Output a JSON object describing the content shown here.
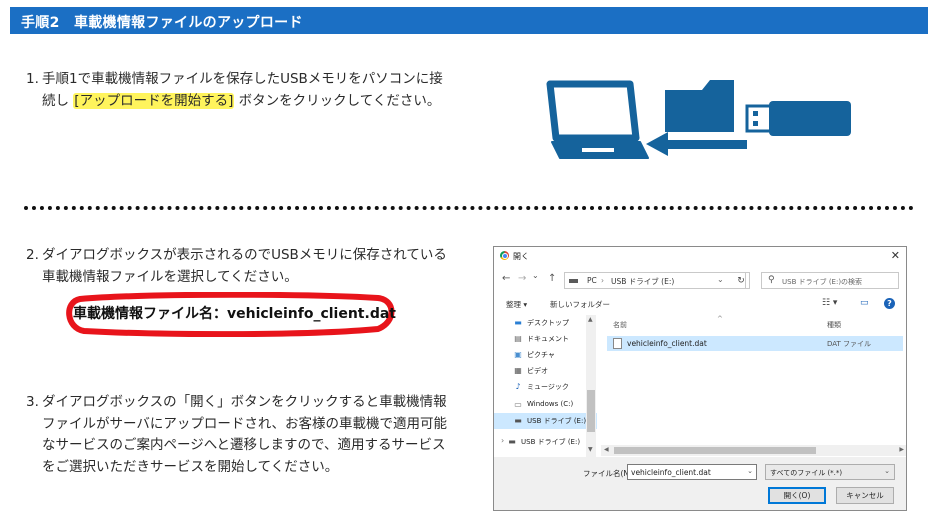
{
  "header": {
    "title": "手順2　車載機情報ファイルのアップロード"
  },
  "colors": {
    "header_bg": "#1b6fc4",
    "highlight": "#fff45c",
    "circle": "#e8141b",
    "illustration": "#15639c"
  },
  "steps": [
    {
      "num": "1.",
      "line1": "手順1で車載機情報ファイルを保存したUSBメモリをパソコンに接",
      "line2_pre": "続し ",
      "highlight": "[アップロードを開始する]",
      "line2_post": " ボタンをクリックしてください。"
    },
    {
      "num": "2.",
      "line1": "ダイアログボックスが表示されるのでUSBメモリに保存されている",
      "line2": "車載機情報ファイルを選択してください。"
    },
    {
      "num": "3.",
      "line1": "ダイアログボックスの「開く」ボタンをクリックすると車載機情報",
      "line2": "ファイルがサーバにアップロードされ、お客様の車載機で適用可能",
      "line3": "なサービスのご案内ページへと遷移しますので、適用するサービス",
      "line4": "をご選択いただきサービスを開始してください。"
    }
  ],
  "filename_note": "車載機情報ファイル名：vehicleinfo_client.dat",
  "icons": {
    "laptop": "laptop-icon",
    "folder": "folder-icon",
    "usb": "usb-icon",
    "arrow": "arrow-left-icon"
  },
  "dialog": {
    "title": "開く",
    "close": "✕",
    "nav": {
      "back": "←",
      "forward": "→",
      "history": "⌄",
      "up": "↑"
    },
    "address": {
      "seg1": "PC",
      "sep": "›",
      "seg2": "USB ドライブ (E:)",
      "dropdown": "⌄"
    },
    "refresh": "↻",
    "search_placeholder": "USB ドライブ (E:)の検索",
    "toolbar": {
      "organize": "整理 ▾",
      "new_folder": "新しいフォルダー",
      "view": "☷ ▾",
      "pane": "▭",
      "help": "?"
    },
    "tree": [
      {
        "label": "デスクトップ",
        "icon": "desktop-icon",
        "glyph": "▬"
      },
      {
        "label": "ドキュメント",
        "icon": "documents-icon",
        "glyph": "▤"
      },
      {
        "label": "ピクチャ",
        "icon": "pictures-icon",
        "glyph": "▣"
      },
      {
        "label": "ビデオ",
        "icon": "videos-icon",
        "glyph": "▦"
      },
      {
        "label": "ミュージック",
        "icon": "music-icon",
        "glyph": "♪"
      },
      {
        "label": "Windows (C:)",
        "icon": "drive-c-icon",
        "glyph": "▭"
      },
      {
        "label": "USB ドライブ (E:)",
        "icon": "usb-drive-icon",
        "glyph": "▬"
      },
      {
        "label": "USB ドライブ (E:)",
        "icon": "usb-drive-icon",
        "glyph": "▬"
      }
    ],
    "columns": {
      "name": "名前",
      "type": "種類",
      "sort": "^"
    },
    "files": [
      {
        "name": "vehicleinfo_client.dat",
        "type": "DAT ファイル"
      }
    ],
    "filename_label": "ファイル名(N):",
    "filename_value": "vehicleinfo_client.dat",
    "filetype": "すべてのファイル (*.*)",
    "open_btn": "開く(O)",
    "cancel_btn": "キャンセル"
  }
}
